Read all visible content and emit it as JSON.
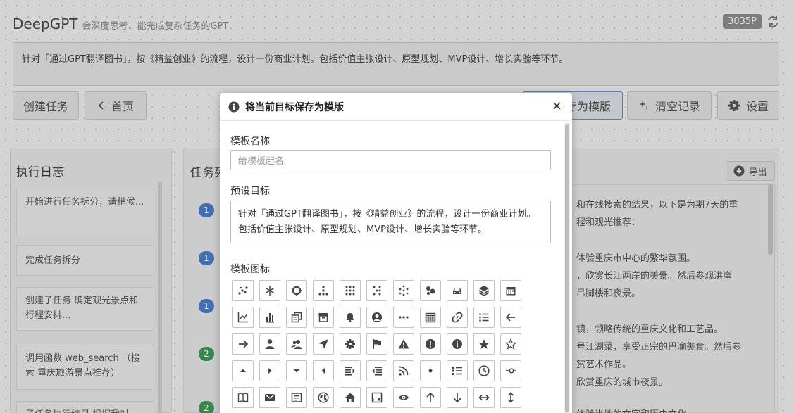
{
  "app": {
    "title": "DeepGPT",
    "subtitle": "会深度思考、能完成复杂任务的GPT",
    "token_count": "3035P"
  },
  "goal": {
    "text": "针对「通过GPT翻译图书」，按《精益创业》的流程，设计一份商业计划。包括价值主张设计、原型规划、MVP设计、增长实验等环节。"
  },
  "toolbar": {
    "create_task": "创建任务",
    "home": "首页",
    "save_template_partial": "存为模版",
    "clear_history": "清空记录",
    "settings": "设置"
  },
  "log_panel": {
    "title": "执行日志",
    "items": [
      "开始进行任务拆分，请稍候...",
      "完成任务拆分",
      "创建子任务 确定观光景点和行程安排...",
      "调用函数 web_search （搜索 重庆旅游景点推荐）",
      "子任务执行结果 根据我对"
    ]
  },
  "task_panel": {
    "title_partial": "任务列",
    "badges": [
      "1",
      "1",
      "1",
      "2",
      "2"
    ],
    "export_label": "导出"
  },
  "result_lines": [
    "和在线搜索的结果，以下是为期7天的重",
    "程和观光推荐：",
    "体验重庆市中心的繁华氛围。",
    "，欣赏长江两岸的美景。然后参观洪崖",
    "吊脚楼和夜景。",
    "镇，领略传统的重庆文化和工艺品。",
    "号江湖菜，享受正宗的巴渝美食。然后参",
    "赏艺术作品。",
    "欣赏重庆的城市夜景。",
    "体验当地的文字和历史文化"
  ],
  "modal": {
    "title": "将当前目标保存为模版",
    "close": "×",
    "name_label": "模板名称",
    "name_placeholder": "给模板起名",
    "goal_label": "预设目标",
    "goal_value": "针对「通过GPT翻译图书」，按《精益创业》的流程，设计一份商业计划。包括价值主张设计、原型规划、MVP设计、增长实验等环节。",
    "icon_label": "模板图标",
    "icons": [
      "scatter-icon",
      "snowflake-icon",
      "gear-ring-icon",
      "dots-tree-icon",
      "grid-dots-icon",
      "dots-cross-icon",
      "dots-diamond-icon",
      "blobs-icon",
      "car-icon",
      "layers-icon",
      "calendar-icon",
      "line-chart-icon",
      "bar-chart-icon",
      "copy-icon",
      "archive-icon",
      "bell-icon",
      "user-circle-icon",
      "more-icon",
      "calendar-grid-icon",
      "link-icon",
      "list-icon",
      "arrow-left-icon",
      "arrow-right-icon",
      "person-icon",
      "people-icon",
      "navigation-icon",
      "settings-icon",
      "flag-icon",
      "warning-icon",
      "alert-icon",
      "info-icon",
      "star-filled-icon",
      "star-outline-icon",
      "caret-up-icon",
      "caret-right-icon",
      "caret-down-icon",
      "caret-left-icon",
      "indent-icon",
      "outdent-icon",
      "rss-icon",
      "dot-icon",
      "list-ordered-icon",
      "clock-icon",
      "git-commit-icon",
      "book-icon",
      "mail-icon",
      "note-icon",
      "globe-icon",
      "home-icon",
      "frame-icon",
      "eye-icon",
      "arrow-up-icon",
      "arrow-down-icon",
      "arrows-h-icon",
      "arrows-v-icon"
    ]
  },
  "colors": {
    "badge_blue": "#4a7fd0",
    "badge_green": "#3f9a57",
    "token_badge": "#8f8f8f"
  }
}
